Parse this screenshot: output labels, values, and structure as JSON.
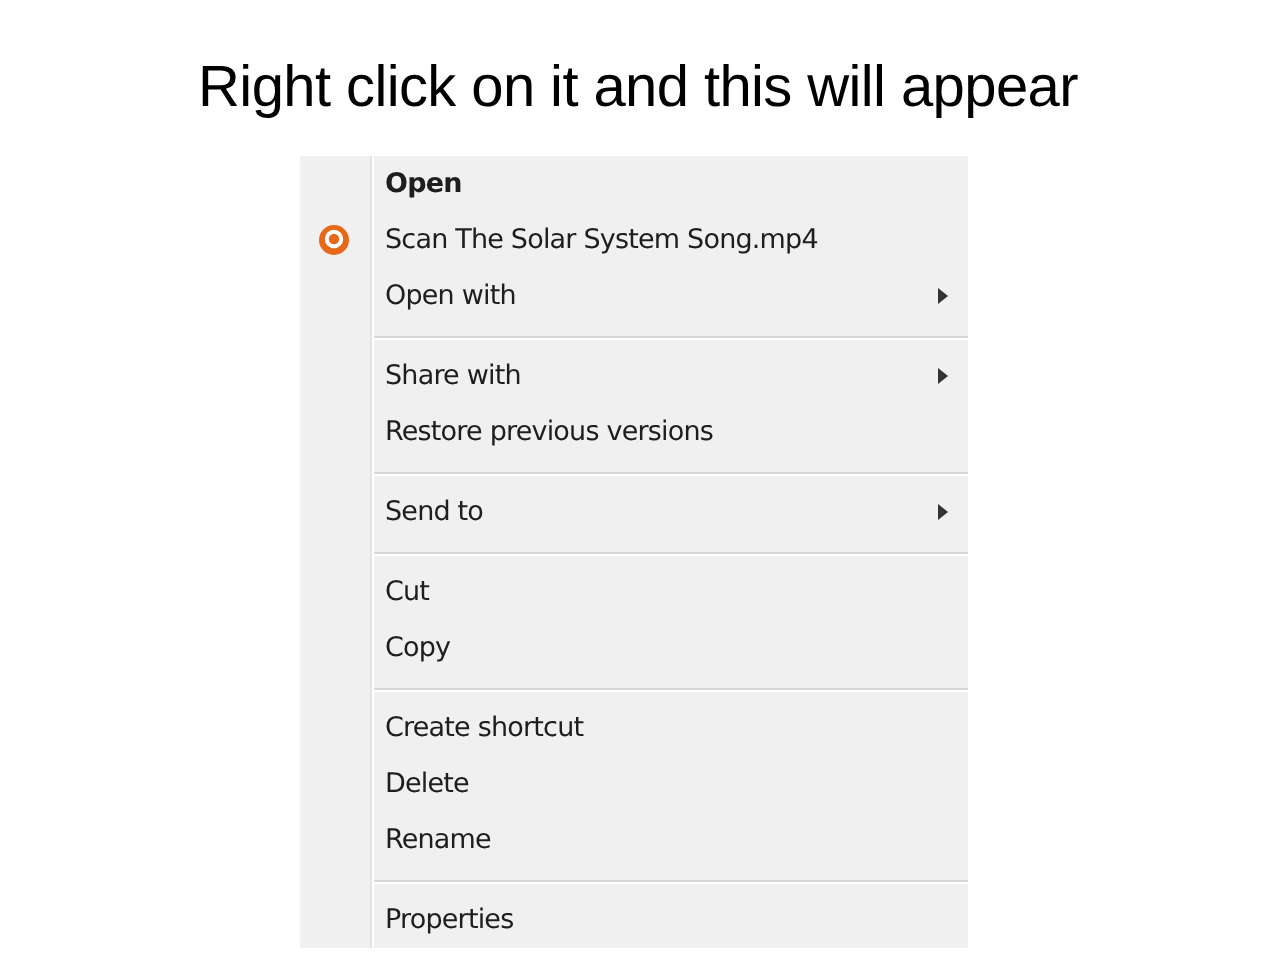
{
  "title": "Right click on it and this will appear",
  "menu": {
    "groups": [
      {
        "items": [
          {
            "label": "Open",
            "kind": "plain",
            "bold": true,
            "submenu": false
          },
          {
            "label": "Scan The Solar System Song.mp4",
            "kind": "app",
            "bold": false,
            "submenu": false
          },
          {
            "label": "Open with",
            "kind": "plain",
            "bold": false,
            "submenu": true
          }
        ]
      },
      {
        "items": [
          {
            "label": "Share with",
            "kind": "plain",
            "bold": false,
            "submenu": true
          },
          {
            "label": "Restore previous versions",
            "kind": "plain",
            "bold": false,
            "submenu": false
          }
        ]
      },
      {
        "items": [
          {
            "label": "Send to",
            "kind": "plain",
            "bold": false,
            "submenu": true
          }
        ]
      },
      {
        "items": [
          {
            "label": "Cut",
            "kind": "plain",
            "bold": false,
            "submenu": false
          },
          {
            "label": "Copy",
            "kind": "plain",
            "bold": false,
            "submenu": false
          }
        ]
      },
      {
        "items": [
          {
            "label": "Create shortcut",
            "kind": "plain",
            "bold": false,
            "submenu": false
          },
          {
            "label": "Delete",
            "kind": "plain",
            "bold": false,
            "submenu": false
          },
          {
            "label": "Rename",
            "kind": "plain",
            "bold": false,
            "submenu": false
          }
        ]
      },
      {
        "items": [
          {
            "label": "Properties",
            "kind": "plain",
            "bold": false,
            "submenu": false
          }
        ]
      }
    ]
  }
}
